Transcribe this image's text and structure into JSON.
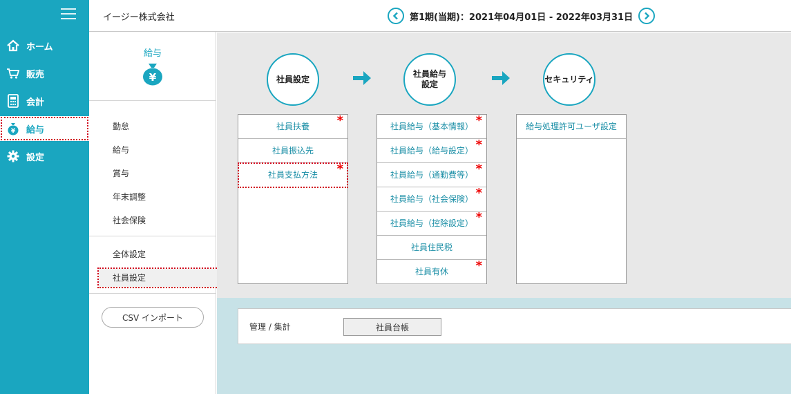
{
  "nav": {
    "items": [
      {
        "label": "ホーム",
        "icon": "home-icon"
      },
      {
        "label": "販売",
        "icon": "cart-icon"
      },
      {
        "label": "会計",
        "icon": "calculator-icon"
      },
      {
        "label": "給与",
        "icon": "money-bag-icon"
      },
      {
        "label": "設定",
        "icon": "gear-icon"
      }
    ],
    "active": "給与"
  },
  "header": {
    "company": "イージー株式会社",
    "period": "第1期(当期)：2021年04月01日 - 2022年03月31日"
  },
  "submenu": {
    "title": "給与",
    "items": [
      "勤怠",
      "給与",
      "賞与",
      "年末調整",
      "社会保険",
      "全体設定",
      "社員設定"
    ],
    "active": "社員設定",
    "csv_button": "CSV インポート"
  },
  "steps": [
    {
      "label1": "社員設定",
      "label2": ""
    },
    {
      "label1": "社員給与",
      "label2": "設定"
    },
    {
      "label1": "セキュリティ",
      "label2": ""
    }
  ],
  "boxes": [
    {
      "items": [
        {
          "label": "社員扶養",
          "required": true
        },
        {
          "label": "社員振込先",
          "required": false
        },
        {
          "label": "社員支払方法",
          "required": true
        }
      ]
    },
    {
      "items": [
        {
          "label": "社員給与（基本情報）",
          "required": true
        },
        {
          "label": "社員給与（給与設定）",
          "required": true
        },
        {
          "label": "社員給与（通勤費等）",
          "required": true
        },
        {
          "label": "社員給与（社会保険）",
          "required": true
        },
        {
          "label": "社員給与（控除設定）",
          "required": true
        },
        {
          "label": "社員住民税",
          "required": false
        },
        {
          "label": "社員有休",
          "required": true
        }
      ]
    },
    {
      "items": [
        {
          "label": "給与処理許可ユーザ設定",
          "required": false
        }
      ]
    }
  ],
  "required_mark": "*",
  "bottom": {
    "label": "管理 / 集計",
    "button": "社員台帳"
  },
  "colors": {
    "accent": "#1aa6c0",
    "required": "#e00000",
    "highlight": "#d0021b"
  }
}
